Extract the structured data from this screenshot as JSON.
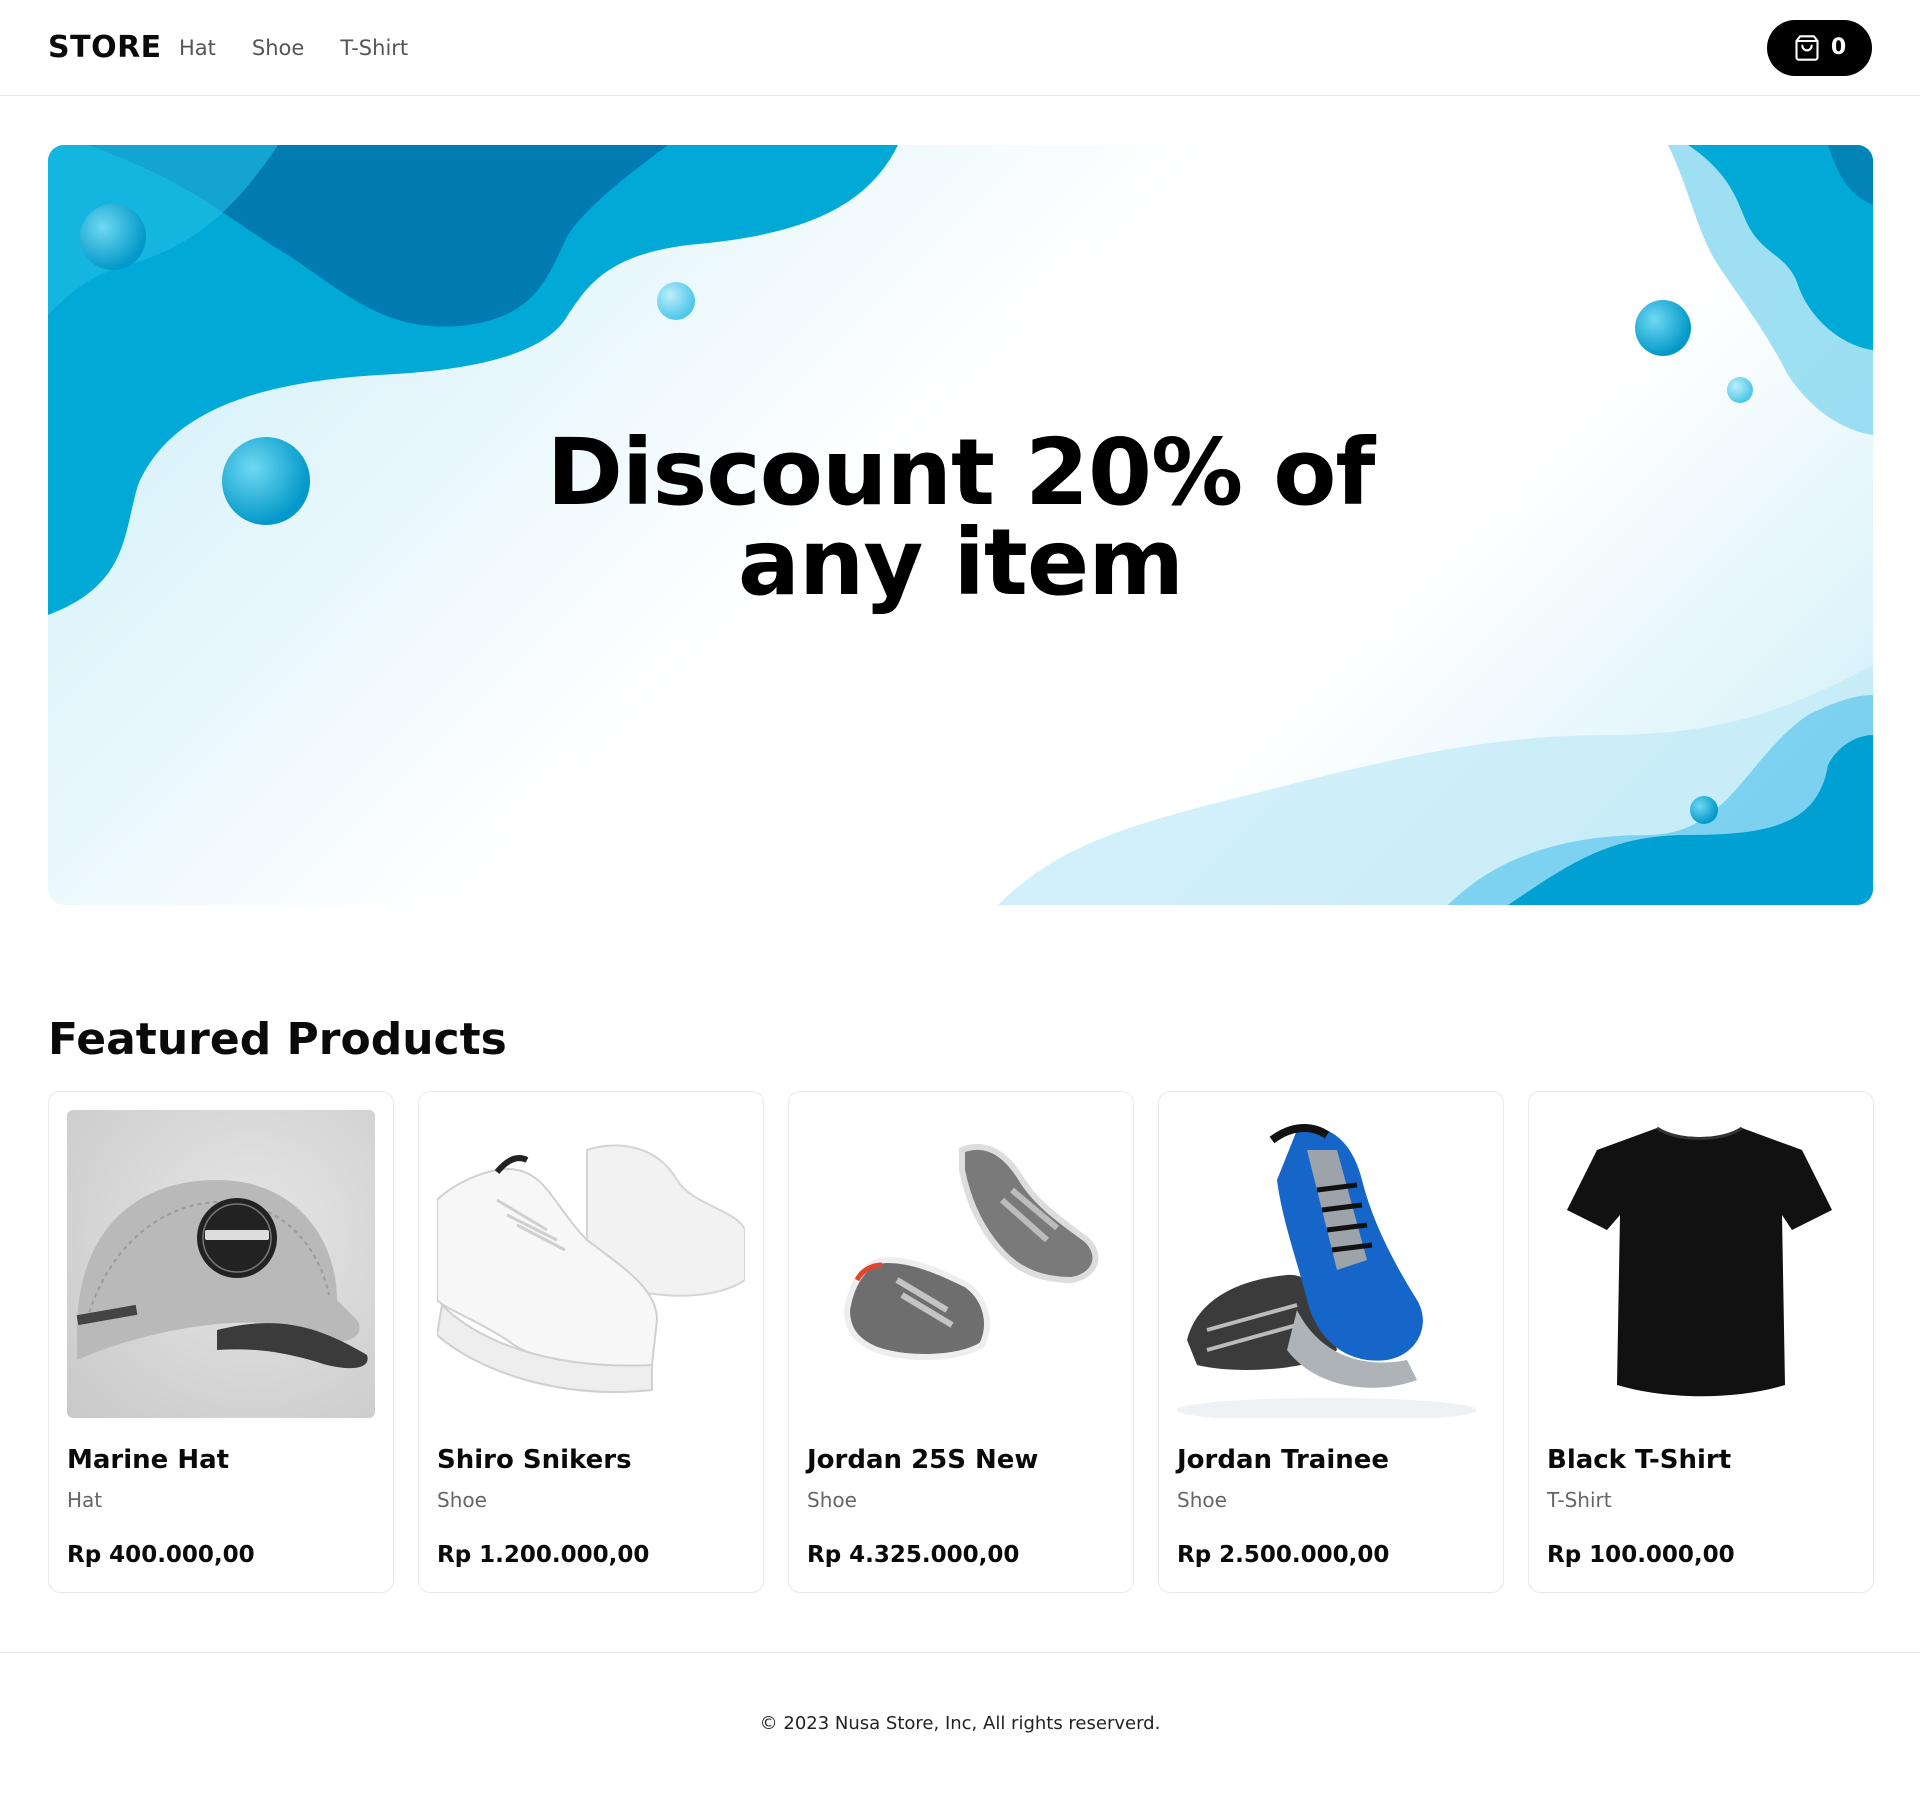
{
  "header": {
    "brand": "STORE",
    "nav": [
      "Hat",
      "Shoe",
      "T-Shirt"
    ],
    "cart_count": "0",
    "cart_icon": "shopping-bag-icon"
  },
  "banner": {
    "title_line1": "Discount 20% of",
    "title_line2": "any item",
    "colors": {
      "accent": "#00b4d8",
      "deep": "#0283b8"
    }
  },
  "featured": {
    "title": "Featured Products",
    "products": [
      {
        "name": "Marine Hat",
        "category": "Hat",
        "price": "Rp 400.000,00",
        "image": "cap-image"
      },
      {
        "name": "Shiro Snikers",
        "category": "Shoe",
        "price": "Rp 1.200.000,00",
        "image": "white-sneakers-image"
      },
      {
        "name": "Jordan 25S New",
        "category": "Shoe",
        "price": "Rp 4.325.000,00",
        "image": "grey-sneakers-image"
      },
      {
        "name": "Jordan Trainee",
        "category": "Shoe",
        "price": "Rp 2.500.000,00",
        "image": "blue-sneakers-image"
      },
      {
        "name": "Black T-Shirt",
        "category": "T-Shirt",
        "price": "Rp 100.000,00",
        "image": "black-tshirt-image"
      }
    ]
  },
  "footer": {
    "copyright": "© 2023 Nusa Store, Inc, All rights reserverd."
  }
}
